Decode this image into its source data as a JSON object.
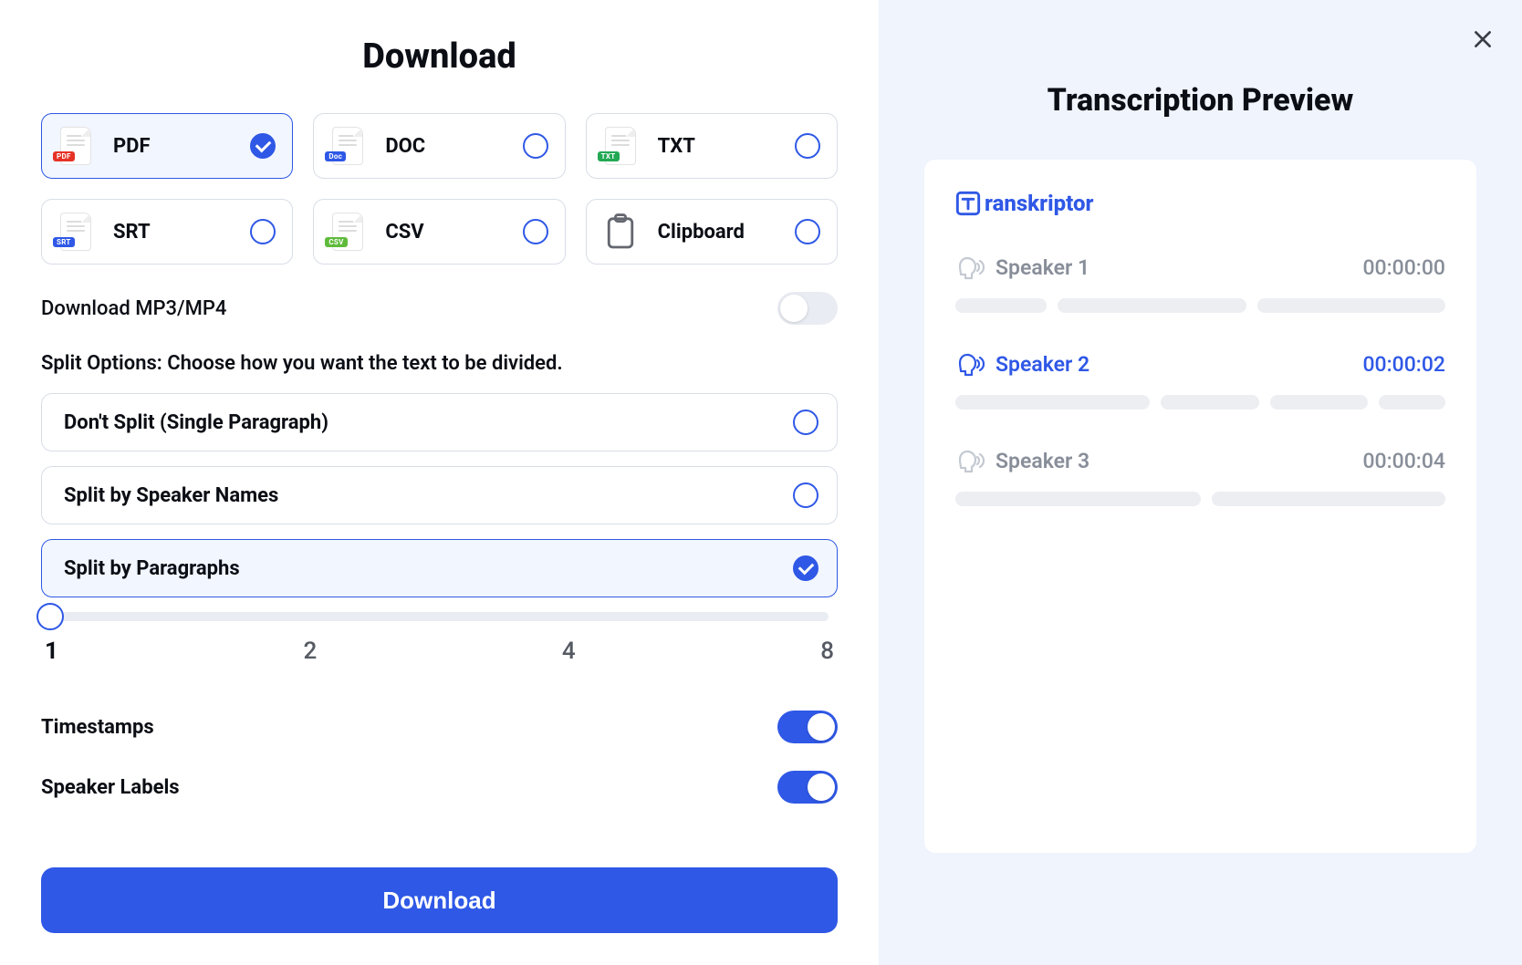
{
  "title": "Download",
  "formats": [
    {
      "key": "pdf",
      "label": "PDF",
      "tag": "PDF",
      "selected": true
    },
    {
      "key": "doc",
      "label": "DOC",
      "tag": "Doc",
      "selected": false
    },
    {
      "key": "txt",
      "label": "TXT",
      "tag": "TXT",
      "selected": false
    },
    {
      "key": "srt",
      "label": "SRT",
      "tag": "SRT",
      "selected": false
    },
    {
      "key": "csv",
      "label": "CSV",
      "tag": "CSV",
      "selected": false
    },
    {
      "key": "clipboard",
      "label": "Clipboard",
      "selected": false
    }
  ],
  "download_media": {
    "label": "Download MP3/MP4",
    "on": false
  },
  "split_heading": "Split Options: Choose how you want the text to be divided.",
  "split_options": [
    {
      "label": "Don't Split (Single Paragraph)",
      "selected": false
    },
    {
      "label": "Split by Speaker Names",
      "selected": false
    },
    {
      "label": "Split by Paragraphs",
      "selected": true
    }
  ],
  "slider": {
    "value": 1,
    "ticks": [
      "1",
      "2",
      "4",
      "8"
    ]
  },
  "timestamps": {
    "label": "Timestamps",
    "on": true
  },
  "speaker_labels": {
    "label": "Speaker Labels",
    "on": true
  },
  "download_button": "Download",
  "preview": {
    "title": "Transcription Preview",
    "brand": "ranskriptor",
    "speakers": [
      {
        "name": "Speaker 1",
        "time": "00:00:00",
        "accent": "gray",
        "bars": [
          85,
          175,
          175
        ]
      },
      {
        "name": "Speaker 2",
        "time": "00:00:02",
        "accent": "blue",
        "bars": [
          175,
          88,
          88,
          60
        ]
      },
      {
        "name": "Speaker 3",
        "time": "00:00:04",
        "accent": "gray",
        "bars": [
          220,
          210
        ]
      }
    ]
  }
}
